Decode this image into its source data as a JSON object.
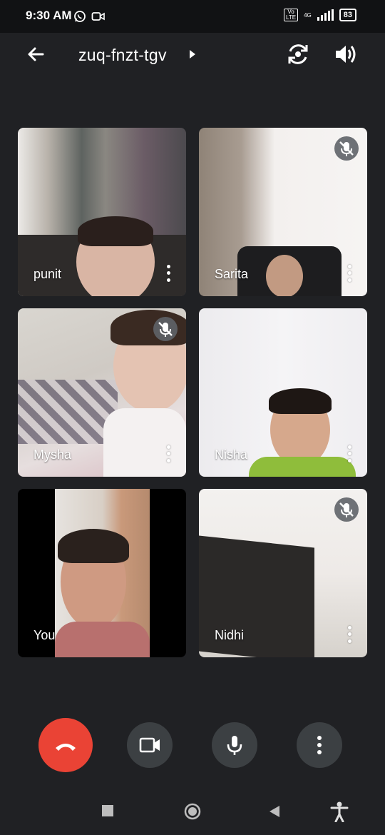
{
  "status_bar": {
    "time": "9:30 AM",
    "network_label": "4G",
    "volte_label": "Vo LTE",
    "battery": "83",
    "notification_icons": [
      "whatsapp-icon",
      "video-record-icon"
    ]
  },
  "header": {
    "meeting_code": "zuq-fnzt-tgv",
    "icons": [
      "back-arrow-icon",
      "caret-right-icon",
      "switch-camera-icon",
      "speaker-volume-icon"
    ]
  },
  "participants": [
    {
      "name": "punit",
      "muted": false
    },
    {
      "name": "Sarita",
      "muted": true
    },
    {
      "name": "Mysha",
      "muted": true
    },
    {
      "name": "Nisha",
      "muted": false
    },
    {
      "name": "You",
      "muted": false
    },
    {
      "name": "Nidhi",
      "muted": true
    }
  ],
  "controls": {
    "icons": [
      "end-call-icon",
      "camera-icon",
      "microphone-icon",
      "more-options-icon"
    ],
    "colors": {
      "end_call": "#ea4335",
      "button": "#3c4043"
    }
  },
  "navbar": {
    "icons": [
      "recents-square-icon",
      "home-circle-icon",
      "back-triangle-icon",
      "accessibility-icon"
    ]
  },
  "colors": {
    "background": "#202124",
    "status_bar": "#111214",
    "mute_badge": "#5f6368"
  }
}
